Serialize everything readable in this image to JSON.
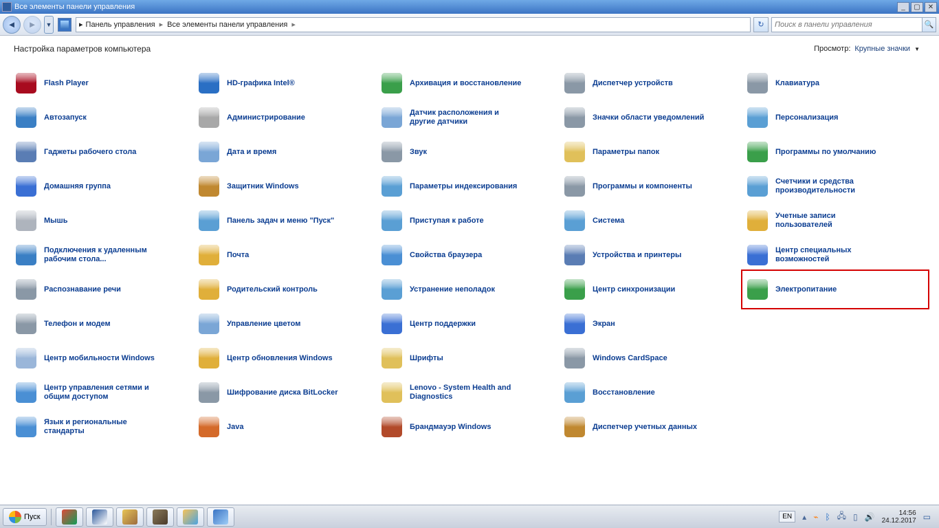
{
  "window": {
    "title": "Все элементы панели управления"
  },
  "breadcrumb": {
    "part1": "Панель управления",
    "part2": "Все элементы панели управления"
  },
  "search": {
    "placeholder": "Поиск в панели управления"
  },
  "page": {
    "heading": "Настройка параметров компьютера",
    "view_label": "Просмотр:",
    "view_value": "Крупные значки"
  },
  "items": [
    {
      "label": "Flash Player",
      "color": "#a80b1f",
      "icon": "flash"
    },
    {
      "label": "Автозапуск",
      "color": "#3a7fc4",
      "icon": "autoplay"
    },
    {
      "label": "Гаджеты рабочего стола",
      "color": "#5a7db4",
      "icon": "gadgets"
    },
    {
      "label": "Домашняя группа",
      "color": "#3a6fd4",
      "icon": "homegroup"
    },
    {
      "label": "Мышь",
      "color": "#aeb4bd",
      "icon": "mouse"
    },
    {
      "label": "Подключения к удаленным рабочим стола...",
      "color": "#3a7fc4",
      "icon": "remote"
    },
    {
      "label": "Распознавание речи",
      "color": "#8a98a6",
      "icon": "speech"
    },
    {
      "label": "Телефон и модем",
      "color": "#8a98a6",
      "icon": "phone"
    },
    {
      "label": "Центр мобильности Windows",
      "color": "#9ab6d9",
      "icon": "mobility"
    },
    {
      "label": "Центр управления сетями и общим доступом",
      "color": "#4a8fd4",
      "icon": "network"
    },
    {
      "label": "Язык и региональные стандарты",
      "color": "#4a8fd4",
      "icon": "region"
    },
    {
      "label": "HD-графика Intel®",
      "color": "#2a6fc4",
      "icon": "intel"
    },
    {
      "label": "Администрирование",
      "color": "#a8a8a8",
      "icon": "admin"
    },
    {
      "label": "Дата и время",
      "color": "#7aa6d6",
      "icon": "datetime"
    },
    {
      "label": "Защитник Windows",
      "color": "#c08830",
      "icon": "defender"
    },
    {
      "label": "Панель задач и меню \"Пуск\"",
      "color": "#5a9fd4",
      "icon": "taskbar"
    },
    {
      "label": "Почта",
      "color": "#e0af3a",
      "icon": "mail"
    },
    {
      "label": "Родительский контроль",
      "color": "#e0af3a",
      "icon": "parental"
    },
    {
      "label": "Управление цветом",
      "color": "#7aa6d6",
      "icon": "color"
    },
    {
      "label": "Центр обновления Windows",
      "color": "#e0af3a",
      "icon": "update"
    },
    {
      "label": "Шифрование диска BitLocker",
      "color": "#8a98a6",
      "icon": "bitlocker"
    },
    {
      "label": "Java",
      "color": "#d46a2a",
      "icon": "java"
    },
    {
      "label": "Архивация и восстановление",
      "color": "#3a9f4a",
      "icon": "backup"
    },
    {
      "label": "Датчик расположения и другие датчики",
      "color": "#7aa6d6",
      "icon": "sensors"
    },
    {
      "label": "Звук",
      "color": "#8a98a6",
      "icon": "sound"
    },
    {
      "label": "Параметры индексирования",
      "color": "#5a9fd4",
      "icon": "indexing"
    },
    {
      "label": "Приступая к работе",
      "color": "#5a9fd4",
      "icon": "getstarted"
    },
    {
      "label": "Свойства браузера",
      "color": "#4a8fd4",
      "icon": "internet"
    },
    {
      "label": "Устранение неполадок",
      "color": "#5a9fd4",
      "icon": "troubleshoot"
    },
    {
      "label": "Центр поддержки",
      "color": "#3a6fd4",
      "icon": "action"
    },
    {
      "label": "Шрифты",
      "color": "#e0c05a",
      "icon": "fonts"
    },
    {
      "label": "Lenovo - System Health and Diagnostics",
      "color": "#e0c05a",
      "icon": "lenovo"
    },
    {
      "label": "Брандмауэр Windows",
      "color": "#b24a2a",
      "icon": "firewall"
    },
    {
      "label": "Диспетчер устройств",
      "color": "#8a98a6",
      "icon": "devmgr"
    },
    {
      "label": "Значки области уведомлений",
      "color": "#8a98a6",
      "icon": "tray"
    },
    {
      "label": "Параметры папок",
      "color": "#e0c05a",
      "icon": "folder"
    },
    {
      "label": "Программы и компоненты",
      "color": "#8a98a6",
      "icon": "programs"
    },
    {
      "label": "Система",
      "color": "#5a9fd4",
      "icon": "system"
    },
    {
      "label": "Устройства и принтеры",
      "color": "#5a7db4",
      "icon": "devices"
    },
    {
      "label": "Центр синхронизации",
      "color": "#3a9f4a",
      "icon": "sync"
    },
    {
      "label": "Экран",
      "color": "#3a6fd4",
      "icon": "display"
    },
    {
      "label": "Windows CardSpace",
      "color": "#8a98a6",
      "icon": "cardspace"
    },
    {
      "label": "Восстановление",
      "color": "#5a9fd4",
      "icon": "recovery"
    },
    {
      "label": "Диспетчер учетных данных",
      "color": "#c08830",
      "icon": "credential"
    },
    {
      "label": "Клавиатура",
      "color": "#8a98a6",
      "icon": "keyboard"
    },
    {
      "label": "Персонализация",
      "color": "#5a9fd4",
      "icon": "personalize"
    },
    {
      "label": "Программы по умолчанию",
      "color": "#3a9f4a",
      "icon": "defaults"
    },
    {
      "label": "Счетчики и средства производительности",
      "color": "#5a9fd4",
      "icon": "perf"
    },
    {
      "label": "Учетные записи пользователей",
      "color": "#e0af3a",
      "icon": "users"
    },
    {
      "label": "Центр специальных возможностей",
      "color": "#3a6fd4",
      "icon": "ease"
    },
    {
      "label": "Электропитание",
      "color": "#3a9f4a",
      "icon": "power",
      "highlight": true
    }
  ],
  "taskbar": {
    "start": "Пуск",
    "lang": "EN",
    "time": "14:56",
    "date": "24.12.2017",
    "apps": [
      {
        "name": "chrome",
        "c1": "#dd4b39",
        "c2": "#0f9d58"
      },
      {
        "name": "word",
        "c1": "#2b579a",
        "c2": "#ffffff"
      },
      {
        "name": "paint",
        "c1": "#e7c558",
        "c2": "#9c6b3e"
      },
      {
        "name": "gimp",
        "c1": "#8a7a5a",
        "c2": "#4a3a2a"
      },
      {
        "name": "explorer",
        "c1": "#f6c35a",
        "c2": "#4aa3e0"
      },
      {
        "name": "control-panel",
        "c1": "#3a74c4",
        "c2": "#9ecdf7"
      }
    ]
  }
}
